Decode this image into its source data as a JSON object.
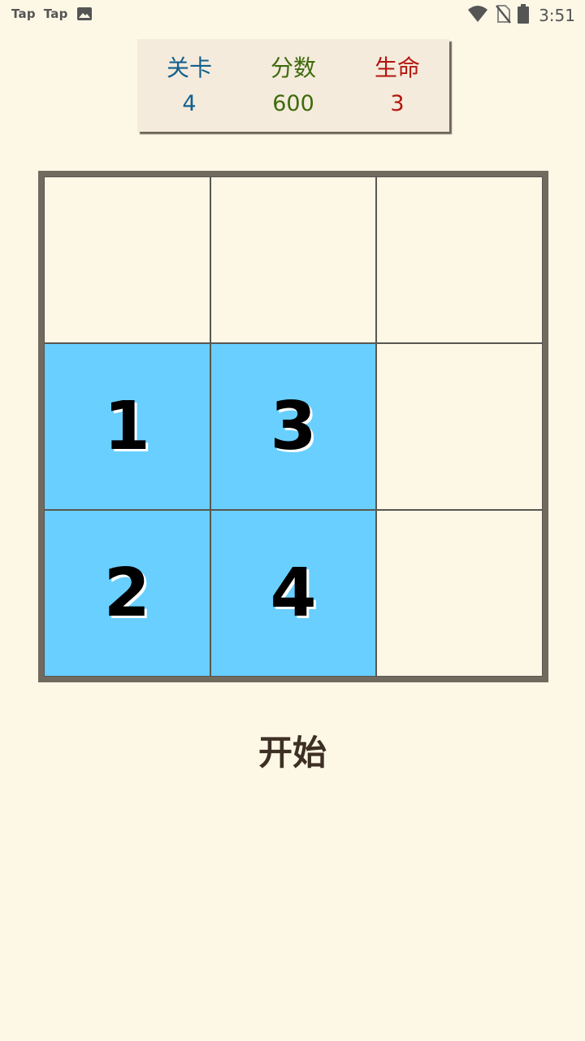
{
  "status_bar": {
    "left_labels": [
      "Tap",
      "Tap"
    ],
    "time": "3:51",
    "icons": [
      "image-icon",
      "wifi-icon",
      "no-sim-icon",
      "battery-icon"
    ]
  },
  "stats": [
    {
      "label": "关卡",
      "value": "4",
      "color": "#14608f"
    },
    {
      "label": "分数",
      "value": "600",
      "color": "#3e6a0c"
    },
    {
      "label": "生命",
      "value": "3",
      "color": "#b3150f"
    }
  ],
  "board": {
    "rows": 3,
    "cols": 3,
    "cells": [
      "",
      "",
      "",
      "1",
      "3",
      "",
      "2",
      "4",
      ""
    ],
    "filled": [
      false,
      false,
      false,
      true,
      true,
      false,
      true,
      true,
      false
    ],
    "filled_color": "#69cfff",
    "empty_color": "#fdf7e6"
  },
  "start_button": {
    "label": "开始"
  }
}
